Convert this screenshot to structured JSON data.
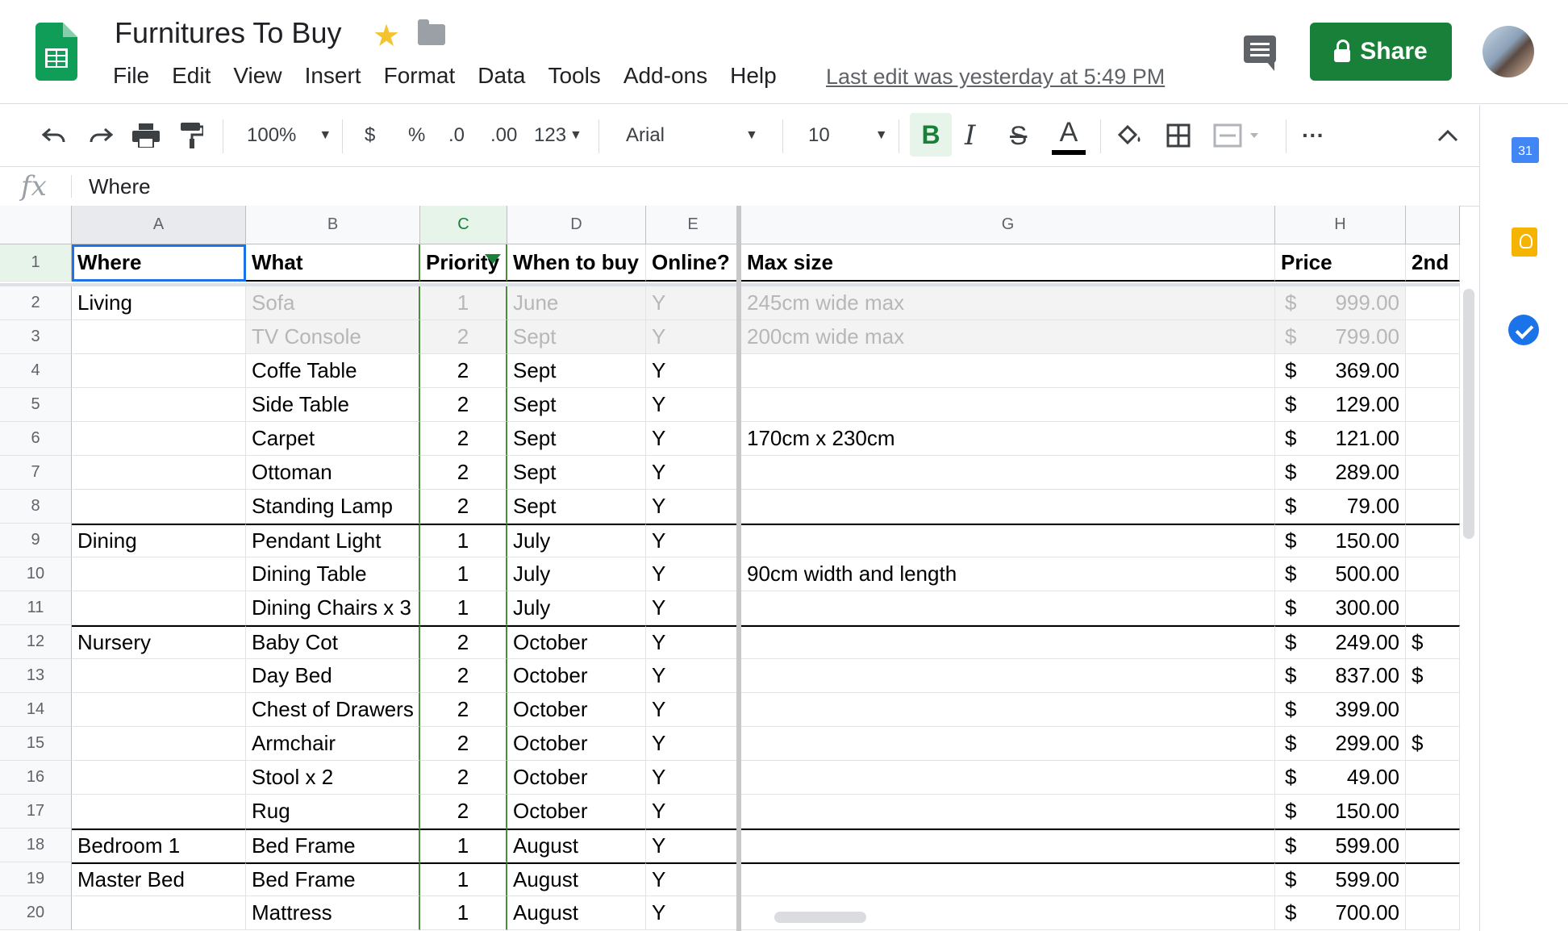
{
  "app": {
    "title": "Furnitures To Buy",
    "star_icon": "star-icon",
    "folder_icon": "folder-icon",
    "menu": [
      "File",
      "Edit",
      "View",
      "Insert",
      "Format",
      "Data",
      "Tools",
      "Add-ons",
      "Help"
    ],
    "last_edit": "Last edit was yesterday at 5:49 PM",
    "share_label": "Share",
    "brand_color": "#188038"
  },
  "toolbar": {
    "zoom": "100%",
    "currency": "$",
    "percent": "%",
    "decrease_decimal": ".0",
    "increase_decimal": ".00",
    "number_format": "123",
    "font": "Arial",
    "font_size": "10",
    "bold": "B",
    "italic": "I",
    "strikethrough": "S",
    "text_color": "A",
    "more": "···"
  },
  "formula_bar": {
    "fx": "fx",
    "value": "Where"
  },
  "side_panel": {
    "calendar_day": "31"
  },
  "sheet": {
    "column_headers": [
      "A",
      "B",
      "C",
      "D",
      "E",
      "G",
      "H",
      ""
    ],
    "header_row": [
      "Where",
      "What",
      "Priority",
      "When to buy",
      "Online?",
      "Max size",
      "Price",
      "2nd"
    ],
    "rows": [
      {
        "num": "1"
      },
      {
        "num": "2",
        "cells": [
          "Living",
          "Sofa",
          "1",
          "June",
          "Y",
          "245cm wide max",
          "$",
          "999.00",
          ""
        ]
      },
      {
        "num": "3",
        "cells": [
          "",
          "TV Console",
          "2",
          "Sept",
          "Y",
          "200cm wide max",
          "$",
          "799.00",
          ""
        ]
      },
      {
        "num": "4",
        "cells": [
          "",
          "Coffe Table",
          "2",
          "Sept",
          "Y",
          "",
          "$",
          "369.00",
          ""
        ]
      },
      {
        "num": "5",
        "cells": [
          "",
          "Side Table",
          "2",
          "Sept",
          "Y",
          "",
          "$",
          "129.00",
          ""
        ]
      },
      {
        "num": "6",
        "cells": [
          "",
          "Carpet",
          "2",
          "Sept",
          "Y",
          "170cm x 230cm",
          "$",
          "121.00",
          ""
        ]
      },
      {
        "num": "7",
        "cells": [
          "",
          "Ottoman",
          "2",
          "Sept",
          "Y",
          "",
          "$",
          "289.00",
          ""
        ]
      },
      {
        "num": "8",
        "cells": [
          "",
          "Standing Lamp",
          "2",
          "Sept",
          "Y",
          "",
          "$",
          "79.00",
          ""
        ]
      },
      {
        "num": "9",
        "cells": [
          "Dining",
          "Pendant Light",
          "1",
          "July",
          "Y",
          "",
          "$",
          "150.00",
          ""
        ]
      },
      {
        "num": "10",
        "cells": [
          "",
          "Dining Table",
          "1",
          "July",
          "Y",
          "90cm width and length",
          "$",
          "500.00",
          ""
        ]
      },
      {
        "num": "11",
        "cells": [
          "",
          "Dining Chairs x 3",
          "1",
          "July",
          "Y",
          "",
          "$",
          "300.00",
          ""
        ]
      },
      {
        "num": "12",
        "cells": [
          "Nursery",
          "Baby Cot",
          "2",
          "October",
          "Y",
          "",
          "$",
          "249.00",
          "$"
        ]
      },
      {
        "num": "13",
        "cells": [
          "",
          "Day Bed",
          "2",
          "October",
          "Y",
          "",
          "$",
          "837.00",
          "$"
        ]
      },
      {
        "num": "14",
        "cells": [
          "",
          "Chest of Drawers",
          "2",
          "October",
          "Y",
          "",
          "$",
          "399.00",
          ""
        ]
      },
      {
        "num": "15",
        "cells": [
          "",
          "Armchair",
          "2",
          "October",
          "Y",
          "",
          "$",
          "299.00",
          "$"
        ]
      },
      {
        "num": "16",
        "cells": [
          "",
          "Stool x 2",
          "2",
          "October",
          "Y",
          "",
          "$",
          "49.00",
          ""
        ]
      },
      {
        "num": "17",
        "cells": [
          "",
          "Rug",
          "2",
          "October",
          "Y",
          "",
          "$",
          "150.00",
          ""
        ]
      },
      {
        "num": "18",
        "cells": [
          "Bedroom 1",
          "Bed Frame",
          "1",
          "August",
          "Y",
          "",
          "$",
          "599.00",
          ""
        ]
      },
      {
        "num": "19",
        "cells": [
          "Master Bed",
          "Bed Frame",
          "1",
          "August",
          "Y",
          "",
          "$",
          "599.00",
          ""
        ]
      },
      {
        "num": "20",
        "cells": [
          "",
          "Mattress",
          "1",
          "August",
          "Y",
          "",
          "$",
          "700.00",
          ""
        ]
      }
    ],
    "faded_rows": [
      "2",
      "3"
    ],
    "group_start_rows": [
      "9",
      "12",
      "18",
      "19"
    ]
  }
}
